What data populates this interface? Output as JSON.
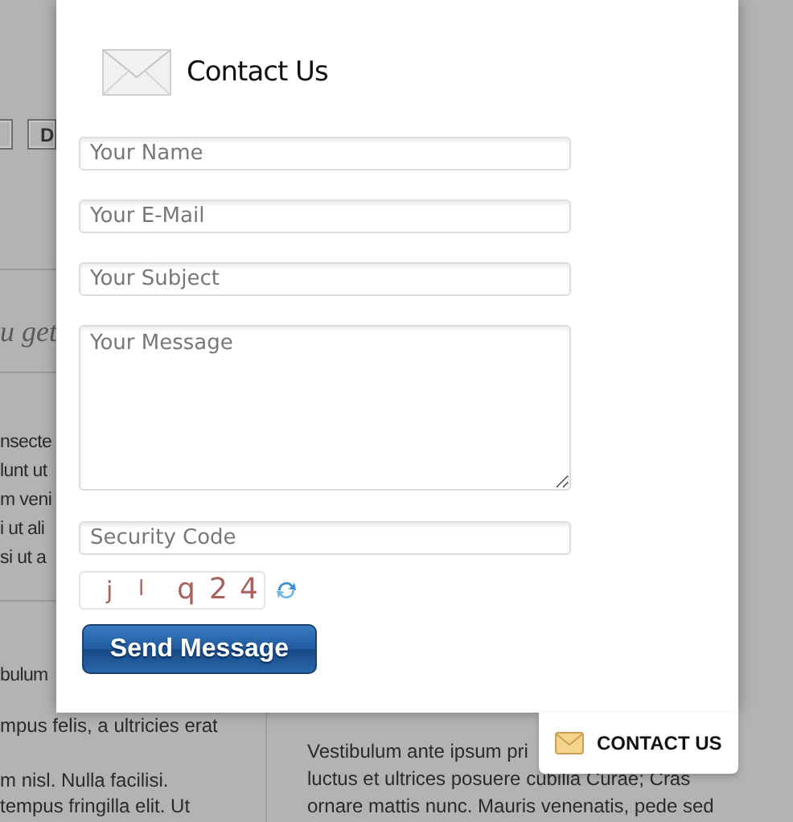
{
  "page": {
    "tab_label": "D",
    "heading_fragment": "u get",
    "left_lines": [
      "nsecte",
      "lunt ut",
      "m veni",
      "i ut ali",
      "si ut a"
    ],
    "left_after": "bulum",
    "left_bottom": [
      "mpus felis, a ultricies erat",
      "m nisl. Nulla facilisi.",
      "tempus fringilla elit. Ut"
    ],
    "right_bottom": [
      "Vestibulum ante ipsum pri",
      "luctus et ultrices posuere cubilia Curae; Cras",
      "ornare mattis nunc. Mauris venenatis, pede sed"
    ]
  },
  "dialog": {
    "title": "Contact Us",
    "fields": [
      {
        "kind": "input",
        "placeholder": "Your Name"
      },
      {
        "kind": "input",
        "placeholder": "Your E-Mail"
      },
      {
        "kind": "input",
        "placeholder": "Your Subject"
      },
      {
        "kind": "textarea",
        "placeholder": "Your Message"
      },
      {
        "kind": "input",
        "placeholder": "Security Code"
      }
    ],
    "captcha": [
      "j",
      "l",
      "q",
      "2",
      "4"
    ],
    "submit": "Send Message"
  },
  "contact_tab": {
    "label": "CONTACT US"
  }
}
